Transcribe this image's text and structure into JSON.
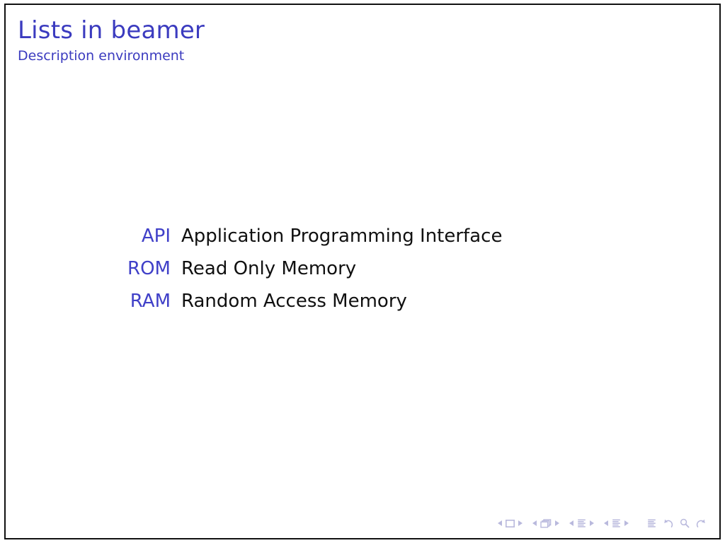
{
  "slide": {
    "title": "Lists in beamer",
    "subtitle": "Description environment",
    "title_color": "#3b3bbf",
    "term_color": "#4040c8",
    "definition_color": "#101010",
    "background_color": "#ffffff",
    "frame_border_color": "#111111",
    "nav_color": "#b9b9dd"
  },
  "description_list": [
    {
      "term": "API",
      "definition": "Application Programming Interface"
    },
    {
      "term": "ROM",
      "definition": "Read Only Memory"
    },
    {
      "term": "RAM",
      "definition": "Random Access Memory"
    }
  ],
  "navigation": {
    "groups": [
      {
        "icon": "slide-icon",
        "prev_label": "previous-slide",
        "next_label": "next-slide"
      },
      {
        "icon": "frame-icon",
        "prev_label": "previous-frame",
        "next_label": "next-frame"
      },
      {
        "icon": "subsection-icon",
        "prev_label": "previous-subsection",
        "next_label": "next-subsection"
      },
      {
        "icon": "section-icon",
        "prev_label": "previous-section",
        "next_label": "next-section"
      }
    ],
    "document_icon": "document-icon",
    "back_icon": "back-arrow-icon",
    "search_icon": "search-icon",
    "forward_icon": "forward-arrow-icon"
  }
}
